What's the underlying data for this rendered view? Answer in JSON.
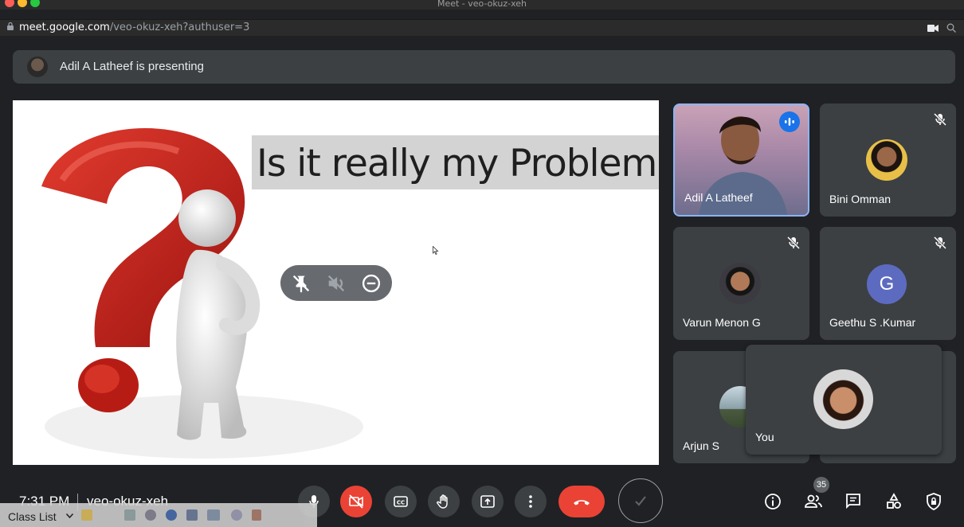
{
  "window": {
    "title": "Meet - veo-okuz-xeh"
  },
  "address_bar": {
    "host": "meet.google.com",
    "path": "/veo-okuz-xeh?authuser=3"
  },
  "presenting_banner": {
    "text": "Adil A Latheef is presenting"
  },
  "slide": {
    "title": "Is it really my Problem ?"
  },
  "participants": [
    {
      "name": "Adil A Latheef",
      "status": "speaking"
    },
    {
      "name": "Bini Omman",
      "status": "muted"
    },
    {
      "name": "Varun Menon G",
      "status": "muted"
    },
    {
      "name": "Geethu S .Kumar",
      "status": "muted",
      "initial": "G",
      "avatar_color": "#5c6bc0"
    },
    {
      "name": "Arjun S"
    }
  ],
  "self_tile": {
    "name": "You"
  },
  "bottom_bar": {
    "time": "7:31 PM",
    "meeting_code": "veo-okuz-xeh",
    "participant_count": "35",
    "end_call_color": "#ea4335",
    "camera_off_color": "#ea4335"
  },
  "taskbar": {
    "label": "Class List"
  },
  "colors": {
    "accent": "#1a73e8",
    "background": "#202124",
    "tile": "#3c4043"
  }
}
